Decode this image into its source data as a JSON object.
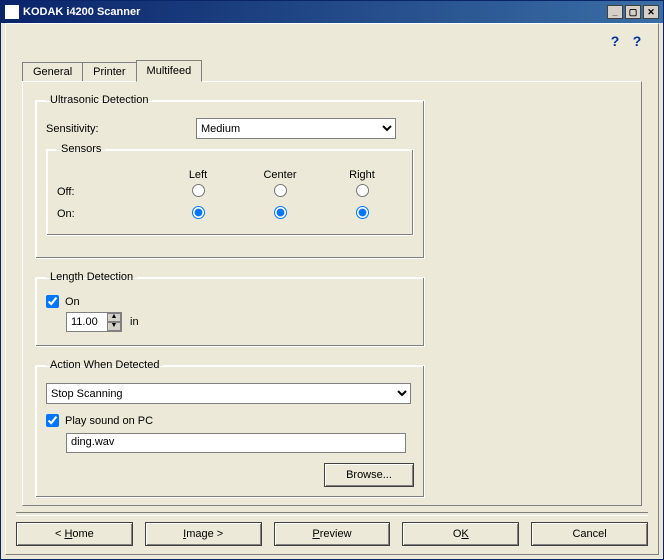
{
  "window": {
    "title": "KODAK i4200 Scanner"
  },
  "tabs": {
    "general": "General",
    "printer": "Printer",
    "multifeed": "Multifeed"
  },
  "ultrasonic": {
    "legend": "Ultrasonic Detection",
    "sensitivity_label": "Sensitivity:",
    "sensitivity_value": "Medium",
    "sensors_legend": "Sensors",
    "col_left": "Left",
    "col_center": "Center",
    "col_right": "Right",
    "row_off": "Off:",
    "row_on": "On:"
  },
  "length": {
    "legend": "Length Detection",
    "on_label": "On",
    "value": "11.00",
    "unit": "in"
  },
  "action": {
    "legend": "Action When Detected",
    "value": "Stop Scanning",
    "play_sound_label": "Play sound on PC",
    "sound_file": "ding.wav",
    "browse_label": "Browse..."
  },
  "buttons": {
    "home": "< Home",
    "image": "Image >",
    "preview": "Preview",
    "ok": "OK",
    "cancel": "Cancel"
  }
}
